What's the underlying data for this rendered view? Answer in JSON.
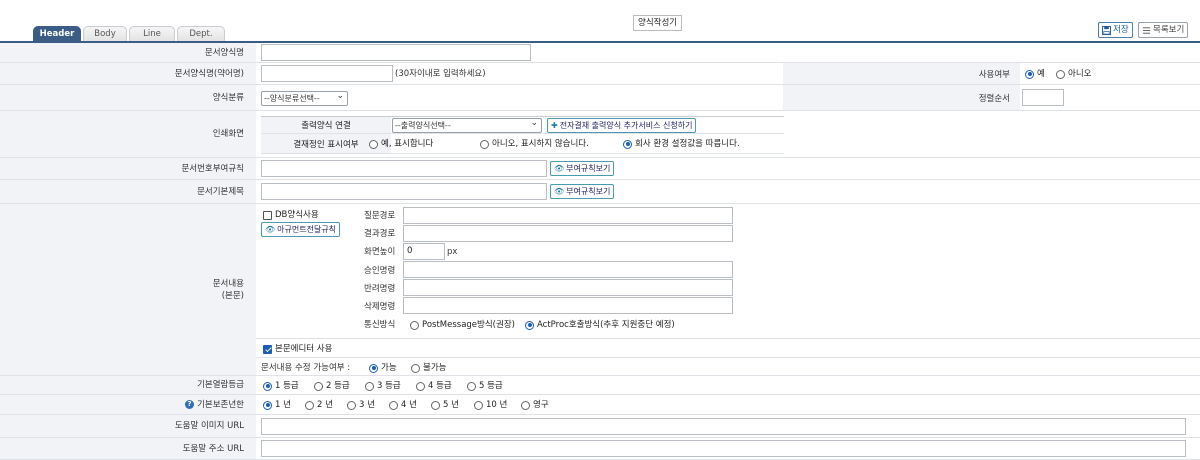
{
  "tabs": [
    "Header",
    "Body",
    "Line",
    "Dept."
  ],
  "form_title": "양식작성기",
  "toolbar": {
    "save": "저장",
    "list": "목록보기"
  },
  "rows": {
    "doc_name": {
      "label": "문서양식명",
      "value": ""
    },
    "doc_abbr": {
      "label": "문서양식명(약어명)",
      "value": "",
      "hint": "(30자이내로 입력하세요)"
    },
    "use_yn": {
      "label": "사용여부",
      "options": [
        "예",
        "아니오"
      ],
      "selected": "예"
    },
    "category": {
      "label": "양식분류",
      "select": "--양식분류선택--"
    },
    "sort": {
      "label": "정렬순서",
      "value": ""
    },
    "print": {
      "label": "인쇄화면",
      "link_label": "출력양식 연결",
      "link_select": "--출력양식선택--",
      "link_button": "전자결재 출력양식 추가서비스 신청하기",
      "display_label": "결재정인 표시여부",
      "display_options": [
        "예, 표시합니다",
        "아니오, 표시하지 않습니다.",
        "회사 환경 설정값을 따릅니다."
      ],
      "display_selected": "회사 환경 설정값을 따릅니다."
    },
    "numbering": {
      "label": "문서번호부여규칙",
      "button": "부여규칙보기"
    },
    "basic_title": {
      "label": "문서기본제목",
      "button": "부여규칙보기"
    },
    "content": {
      "label_line1": "문서내용",
      "label_line2": "(본문)",
      "db_use": "DB양식사용",
      "arg_button": "아규먼트전달규칙",
      "fields": {
        "query": "질문경로",
        "result": "결과경로",
        "height": "화면높이",
        "height_value": "0",
        "height_unit": "px",
        "approve": "승인명령",
        "reject": "반려명령",
        "delete": "삭제명령",
        "comm": "통신방식"
      },
      "comm_options": [
        "PostMessage방식(권장)",
        "ActProc호출방식(추후 지원중단 예정)"
      ],
      "comm_selected": "ActProc호출방식(추후 지원중단 예정)",
      "editor_use": "본문에디터 사용",
      "editable_label": "문서내용 수정 가능여부 :",
      "editable_options": [
        "가능",
        "불가능"
      ],
      "editable_selected": "가능"
    },
    "grade": {
      "label": "기본열람등급",
      "options": [
        "1 등급",
        "2 등급",
        "3 등급",
        "4 등급",
        "5 등급"
      ],
      "selected": "1 등급"
    },
    "retention": {
      "label": "기본보존년한",
      "options": [
        "1 년",
        "2 년",
        "3 년",
        "4 년",
        "5 년",
        "10 년",
        "영구"
      ],
      "selected": "1 년"
    },
    "help_image": {
      "label": "도움말 이미지 URL",
      "value": ""
    },
    "help_url": {
      "label": "도움말 주소 URL",
      "value": ""
    }
  },
  "colors": {
    "tab_active": "#3b5d85",
    "label_bg": "#f1f3f6",
    "radio": "#1a5fb4"
  }
}
